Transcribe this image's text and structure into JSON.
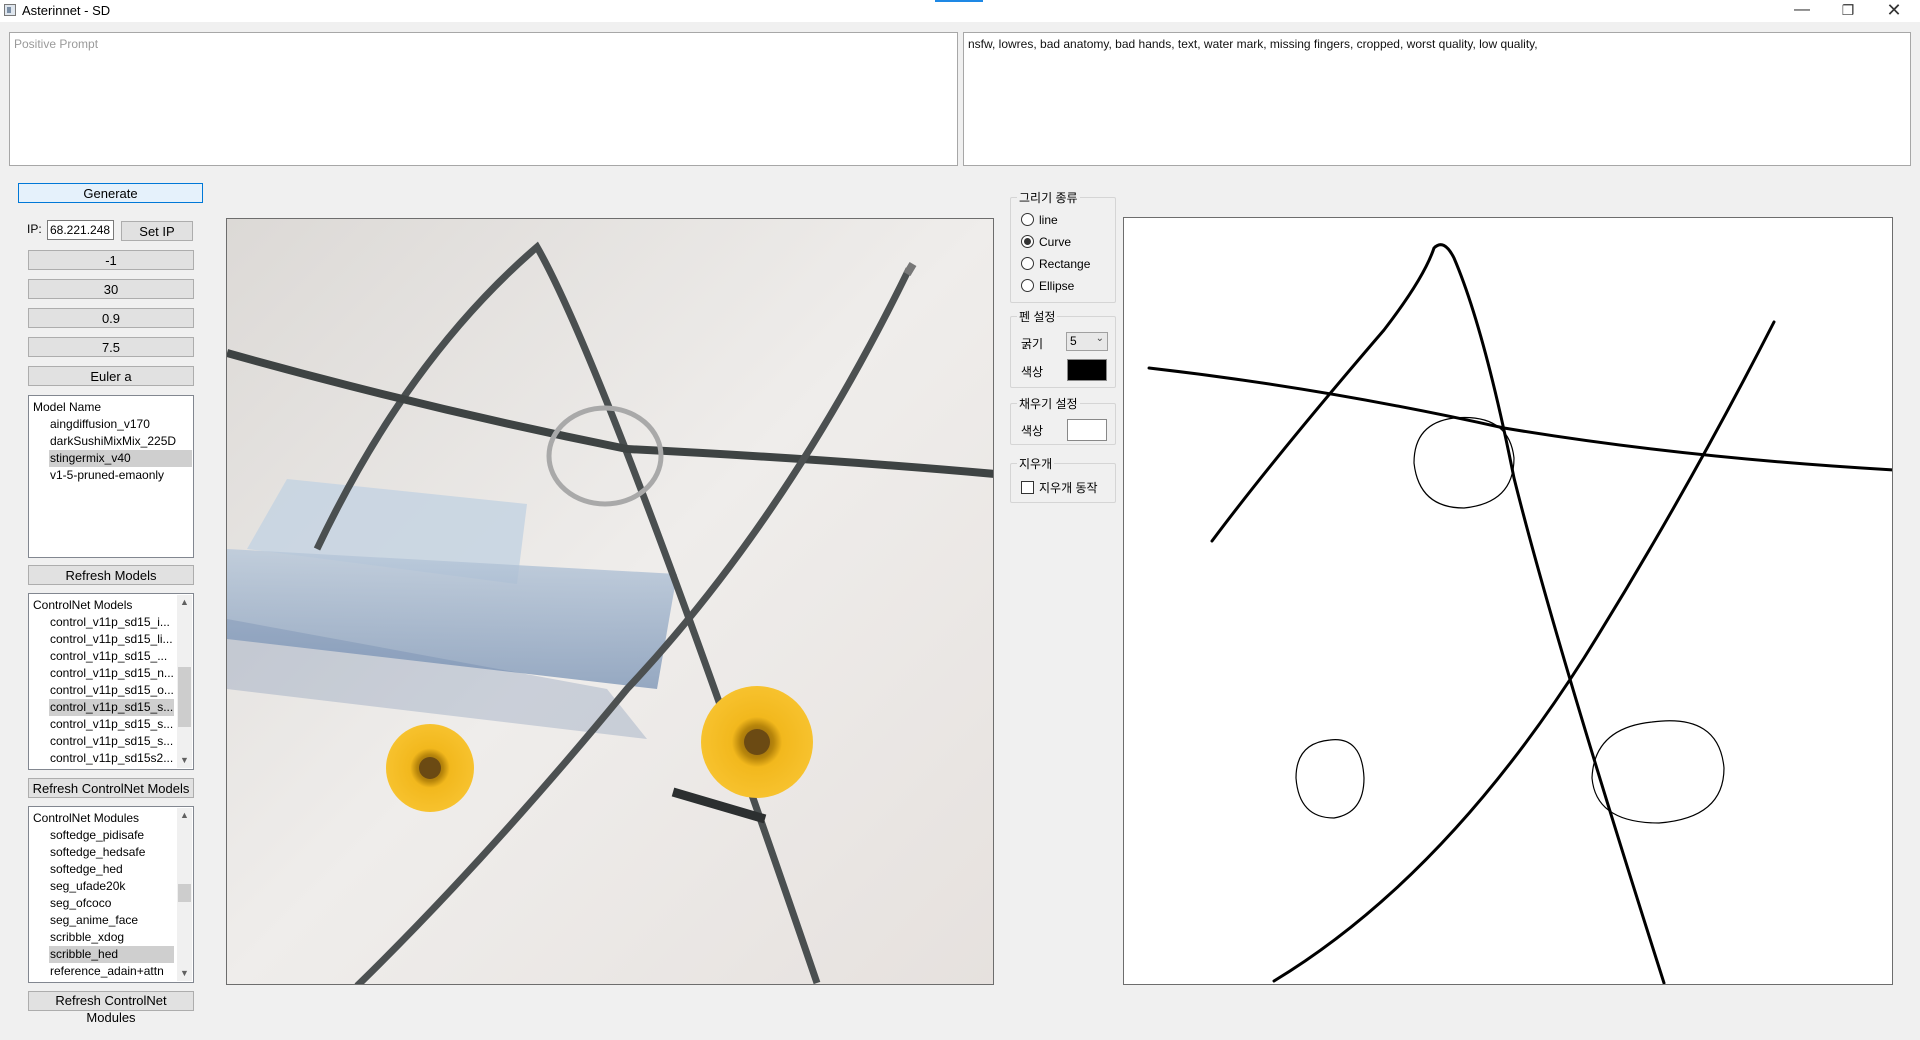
{
  "window": {
    "title": "Asterinnet - SD",
    "minimize": "—",
    "maximize": "❐",
    "close": "✕"
  },
  "prompts": {
    "positive_placeholder": "Positive Prompt",
    "positive_value": "",
    "negative_value": "nsfw, lowres, bad anatomy, bad hands, text, water mark, missing fingers, cropped, worst quality, low quality,"
  },
  "controls": {
    "generate_label": "Generate",
    "ip_label": "IP:",
    "ip_value": "68.221.248",
    "set_ip_label": "Set IP",
    "seed_value": "-1",
    "steps_value": "30",
    "denoise_value": "0.9",
    "cfg_value": "7.5",
    "sampler_value": "Euler a"
  },
  "models": {
    "header": "Model Name",
    "items": [
      "aingdiffusion_v170",
      "darkSushiMixMix_225D",
      "stingermix_v40",
      "v1-5-pruned-emaonly"
    ],
    "selected_index": 2,
    "refresh_label": "Refresh Models"
  },
  "controlnet_models": {
    "header": "ControlNet Models",
    "items": [
      "control_v11p_sd15_i...",
      "control_v11p_sd15_li...",
      "control_v11p_sd15_...",
      "control_v11p_sd15_n...",
      "control_v11p_sd15_o...",
      "control_v11p_sd15_s...",
      "control_v11p_sd15_s...",
      "control_v11p_sd15_s...",
      "control_v11p_sd15s2..."
    ],
    "selected_index": 5,
    "refresh_label": "Refresh ControlNet Models"
  },
  "controlnet_modules": {
    "header": "ControlNet Modules",
    "items": [
      "softedge_pidisafe",
      "softedge_hedsafe",
      "softedge_hed",
      "seg_ufade20k",
      "seg_ofcoco",
      "seg_anime_face",
      "scribble_xdog",
      "scribble_hed",
      "reference_adain+attn"
    ],
    "selected_index": 7,
    "refresh_label": "Refresh ControlNet Modules"
  },
  "draw_type": {
    "title": "그리기 종류",
    "options": [
      "line",
      "Curve",
      "Rectange",
      "Ellipse"
    ],
    "selected": "Curve"
  },
  "pen": {
    "title": "펜 설정",
    "size_label": "굵기",
    "size_value": "5",
    "color_label": "색상",
    "color": "#000000"
  },
  "fill": {
    "title": "채우기 설정",
    "color_label": "색상",
    "color": "#ffffff"
  },
  "eraser": {
    "title": "지우개",
    "checkbox_label": "지우개 동작",
    "checked": false
  }
}
